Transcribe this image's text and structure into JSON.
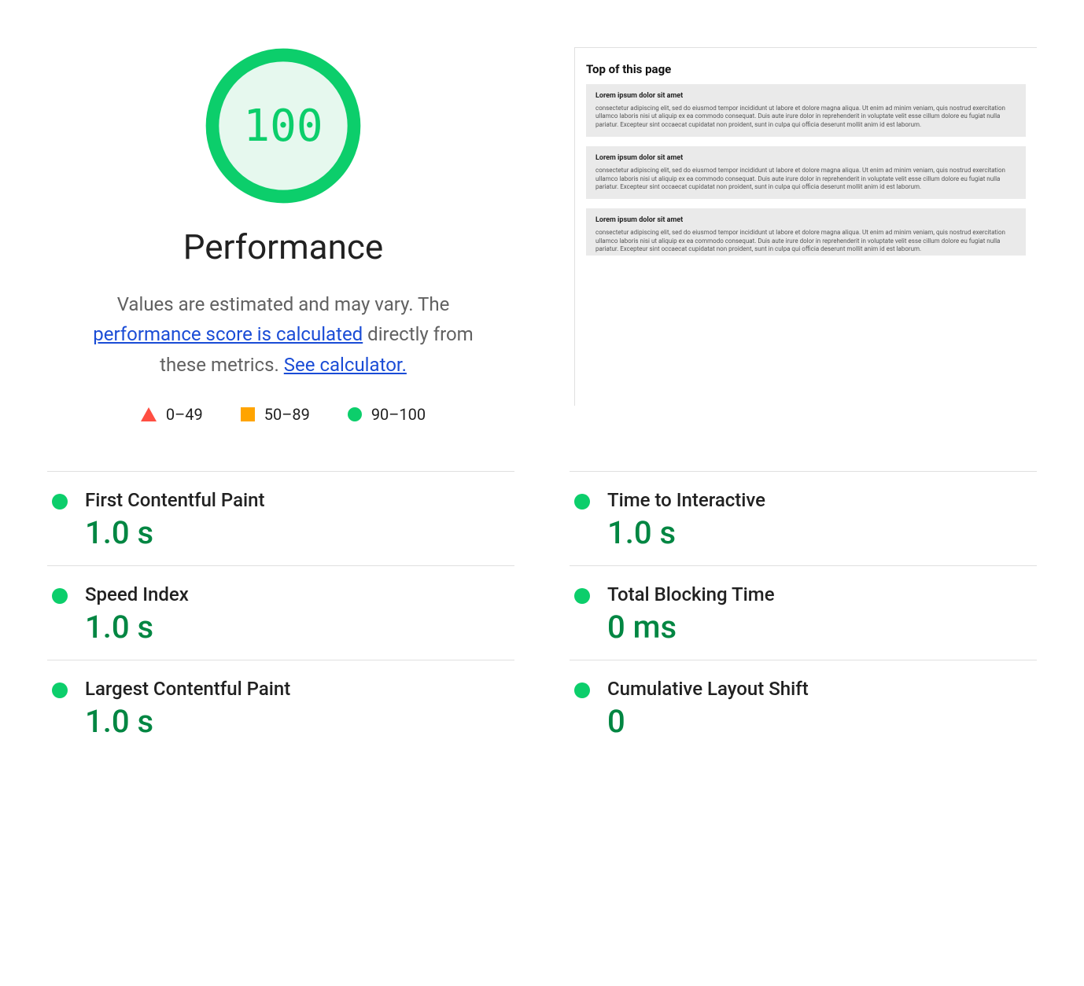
{
  "accent_pass": "#0cce6b",
  "accent_value": "#018642",
  "score": "100",
  "category": "Performance",
  "description": {
    "pre": "Values are estimated and may vary. The ",
    "link1": "performance score is calculated",
    "mid": " directly from these metrics. ",
    "link2": "See calculator."
  },
  "legend": {
    "fail": "0–49",
    "average": "50–89",
    "pass": "90–100"
  },
  "thumbnail": {
    "title": "Top of this page",
    "block_heading": "Lorem ipsum dolor sit amet",
    "block_body": "consectetur adipiscing elit, sed do eiusmod tempor incididunt ut labore et dolore magna aliqua. Ut enim ad minim veniam, quis nostrud exercitation ullamco laboris nisi ut aliquip ex ea commodo consequat. Duis aute irure dolor in reprehenderit in voluptate velit esse cillum dolore eu fugiat nulla pariatur. Excepteur sint occaecat cupidatat non proident, sunt in culpa qui officia deserunt mollit anim id est laborum."
  },
  "metrics": [
    {
      "name": "First Contentful Paint",
      "value": "1.0 s",
      "status": "pass"
    },
    {
      "name": "Time to Interactive",
      "value": "1.0 s",
      "status": "pass"
    },
    {
      "name": "Speed Index",
      "value": "1.0 s",
      "status": "pass"
    },
    {
      "name": "Total Blocking Time",
      "value": "0 ms",
      "status": "pass"
    },
    {
      "name": "Largest Contentful Paint",
      "value": "1.0 s",
      "status": "pass"
    },
    {
      "name": "Cumulative Layout Shift",
      "value": "0",
      "status": "pass"
    }
  ]
}
